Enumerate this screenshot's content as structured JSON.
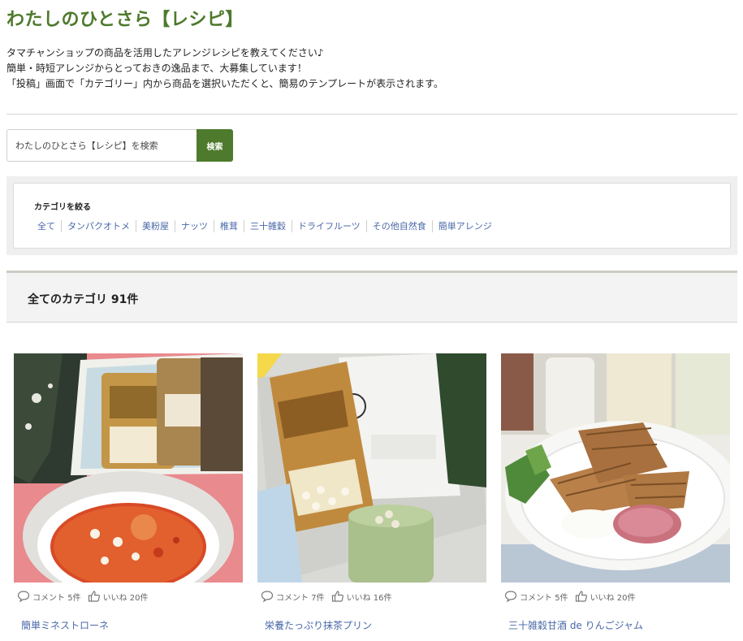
{
  "page": {
    "title": "わたしのひとさら【レシピ】",
    "intro": [
      "タマチャンショップの商品を活用したアレンジレシピを教えてください♪",
      "簡単・時短アレンジからとっておきの逸品まで、大募集しています！",
      "「投稿」画面で「カテゴリー」内から商品を選択いただくと、簡易のテンプレートが表示されます。"
    ]
  },
  "search": {
    "placeholder": "わたしのひとさら【レシピ】を検索",
    "button_label": "検索"
  },
  "filter": {
    "heading": "カテゴリを絞る",
    "categories": [
      "全て",
      "タンパクオトメ",
      "美粉屋",
      "ナッツ",
      "椎茸",
      "三十雑穀",
      "ドライフルーツ",
      "その他自然食",
      "簡単アレンジ"
    ]
  },
  "results": {
    "title": "全てのカテゴリ 91件"
  },
  "cards": [
    {
      "title": "簡単ミネストローネ",
      "comment_label": "コメント",
      "comments": "5件",
      "like_label": "いいね",
      "likes": "20件",
      "image": "minestrone-photo"
    },
    {
      "title": "栄養たっぷり抹茶プリン",
      "comment_label": "コメント",
      "comments": "7件",
      "like_label": "いいね",
      "likes": "16件",
      "image": "matcha-pudding-photo"
    },
    {
      "title": "三十雑穀甘酒 de りんごジャム",
      "comment_label": "コメント",
      "comments": "5件",
      "like_label": "いいね",
      "likes": "20件",
      "image": "waffle-jam-photo"
    }
  ],
  "colors": {
    "brand_green": "#4d7a2c",
    "link_blue": "#4a68a8"
  },
  "icons": {
    "comment": "speech-bubble-icon",
    "like": "thumbs-up-icon"
  }
}
